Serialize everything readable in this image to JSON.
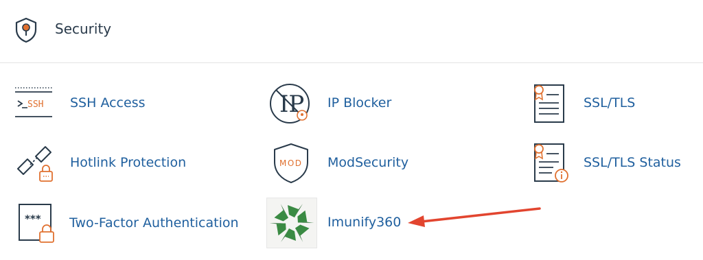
{
  "section": {
    "title": "Security",
    "icon": "shield-icon"
  },
  "items": [
    {
      "label": "SSH Access",
      "icon": "ssh-terminal-icon",
      "icon_text": "SSH"
    },
    {
      "label": "IP Blocker",
      "icon": "ip-blocker-icon",
      "icon_text": "IP"
    },
    {
      "label": "SSL/TLS",
      "icon": "certificate-icon"
    },
    {
      "label": "Hotlink Protection",
      "icon": "broken-link-lock-icon"
    },
    {
      "label": "ModSecurity",
      "icon": "mod-shield-icon",
      "icon_text": "MOD"
    },
    {
      "label": "SSL/TLS Status",
      "icon": "certificate-info-icon"
    },
    {
      "label": "Two-Factor Authentication",
      "icon": "password-lock-icon",
      "icon_text": "***"
    },
    {
      "label": "Imunify360",
      "icon": "imunify360-logo-icon"
    }
  ],
  "annotation": {
    "type": "arrow",
    "points_to": "Imunify360",
    "color": "#e2452f"
  },
  "colors": {
    "accent": "#e0702f",
    "link": "#1f5f9e",
    "icon_stroke": "#293a4a",
    "logo_green": "#3a8a43"
  }
}
